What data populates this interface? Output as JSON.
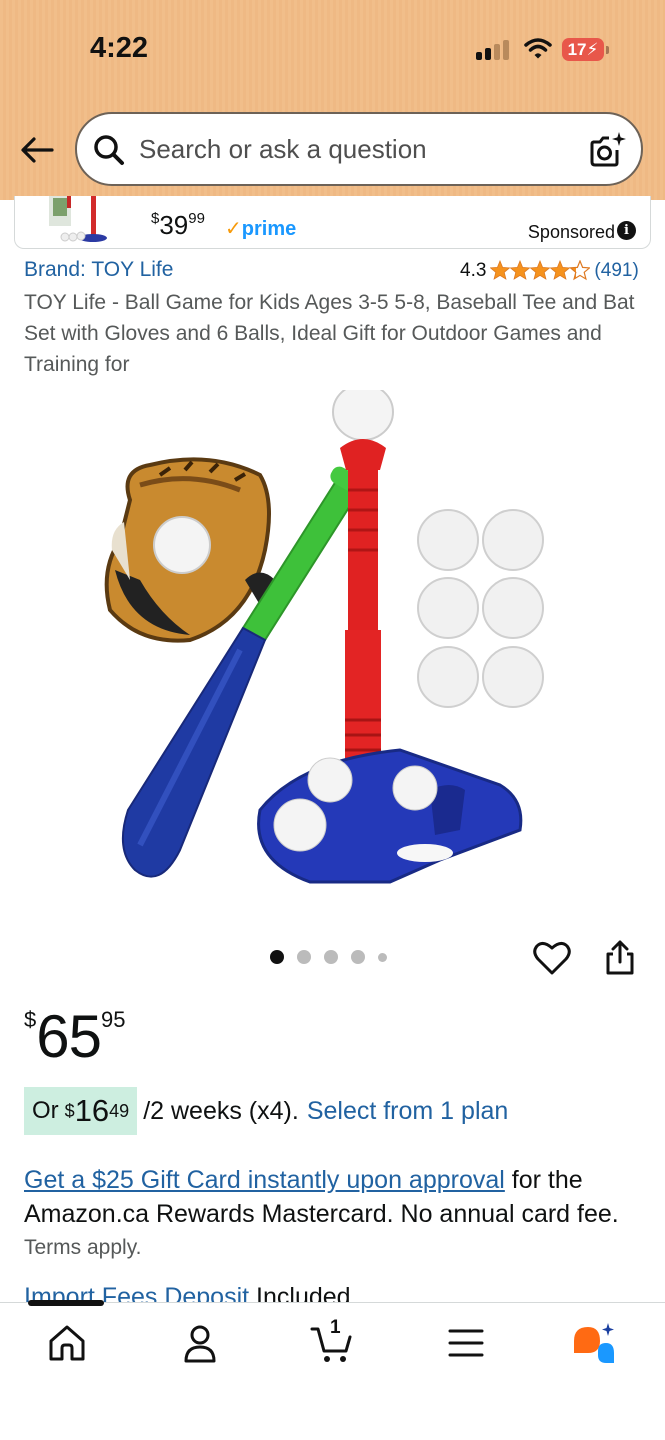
{
  "status_bar": {
    "time": "4:22",
    "battery": "17"
  },
  "search": {
    "placeholder": "Search or ask a question"
  },
  "sponsored_card": {
    "price_whole": "39",
    "price_fraction": "99",
    "price_symbol": "$",
    "prime_check": "✓",
    "prime_label": "prime",
    "sponsored_label": "Sponsored"
  },
  "product": {
    "brand": "Brand: TOY Life",
    "rating_value": "4.3",
    "rating_stars": 4.3,
    "rating_count": "(491)",
    "title": "TOY Life - Ball Game for Kids Ages 3-5 5-8, Baseball Tee and Bat Set with Gloves and 6 Balls, Ideal Gift for Outdoor Games and Training for",
    "image_dots_total": 5,
    "image_dots_active": 1
  },
  "price": {
    "symbol": "$",
    "whole": "65",
    "fraction": "95"
  },
  "installment": {
    "prefix": "Or",
    "symbol": "$",
    "whole": "16",
    "fraction": "49",
    "term": "/2 weeks (x4).",
    "link": "Select from 1 plan"
  },
  "card_offer": {
    "link": "Get a $25 Gift Card instantly upon approval",
    "text": " for the Amazon.ca Rewards Mastercard. No annual card fee.",
    "terms": "Terms apply."
  },
  "import_fees": {
    "link": "Import Fees Deposit",
    "text": " Included"
  },
  "bottom_nav": {
    "items": [
      "home-icon",
      "account-icon",
      "cart-icon",
      "menu-icon",
      "rufus-icon"
    ],
    "cart_count": "1"
  },
  "colors": {
    "header_bg": "#f1be8a",
    "link": "#2162a1",
    "star": "#f5921d",
    "installment_bg": "#cdeee0",
    "prime": "#1a98ff",
    "rufus_orange": "#ff6a13",
    "rufus_blue": "#1a98ff"
  }
}
